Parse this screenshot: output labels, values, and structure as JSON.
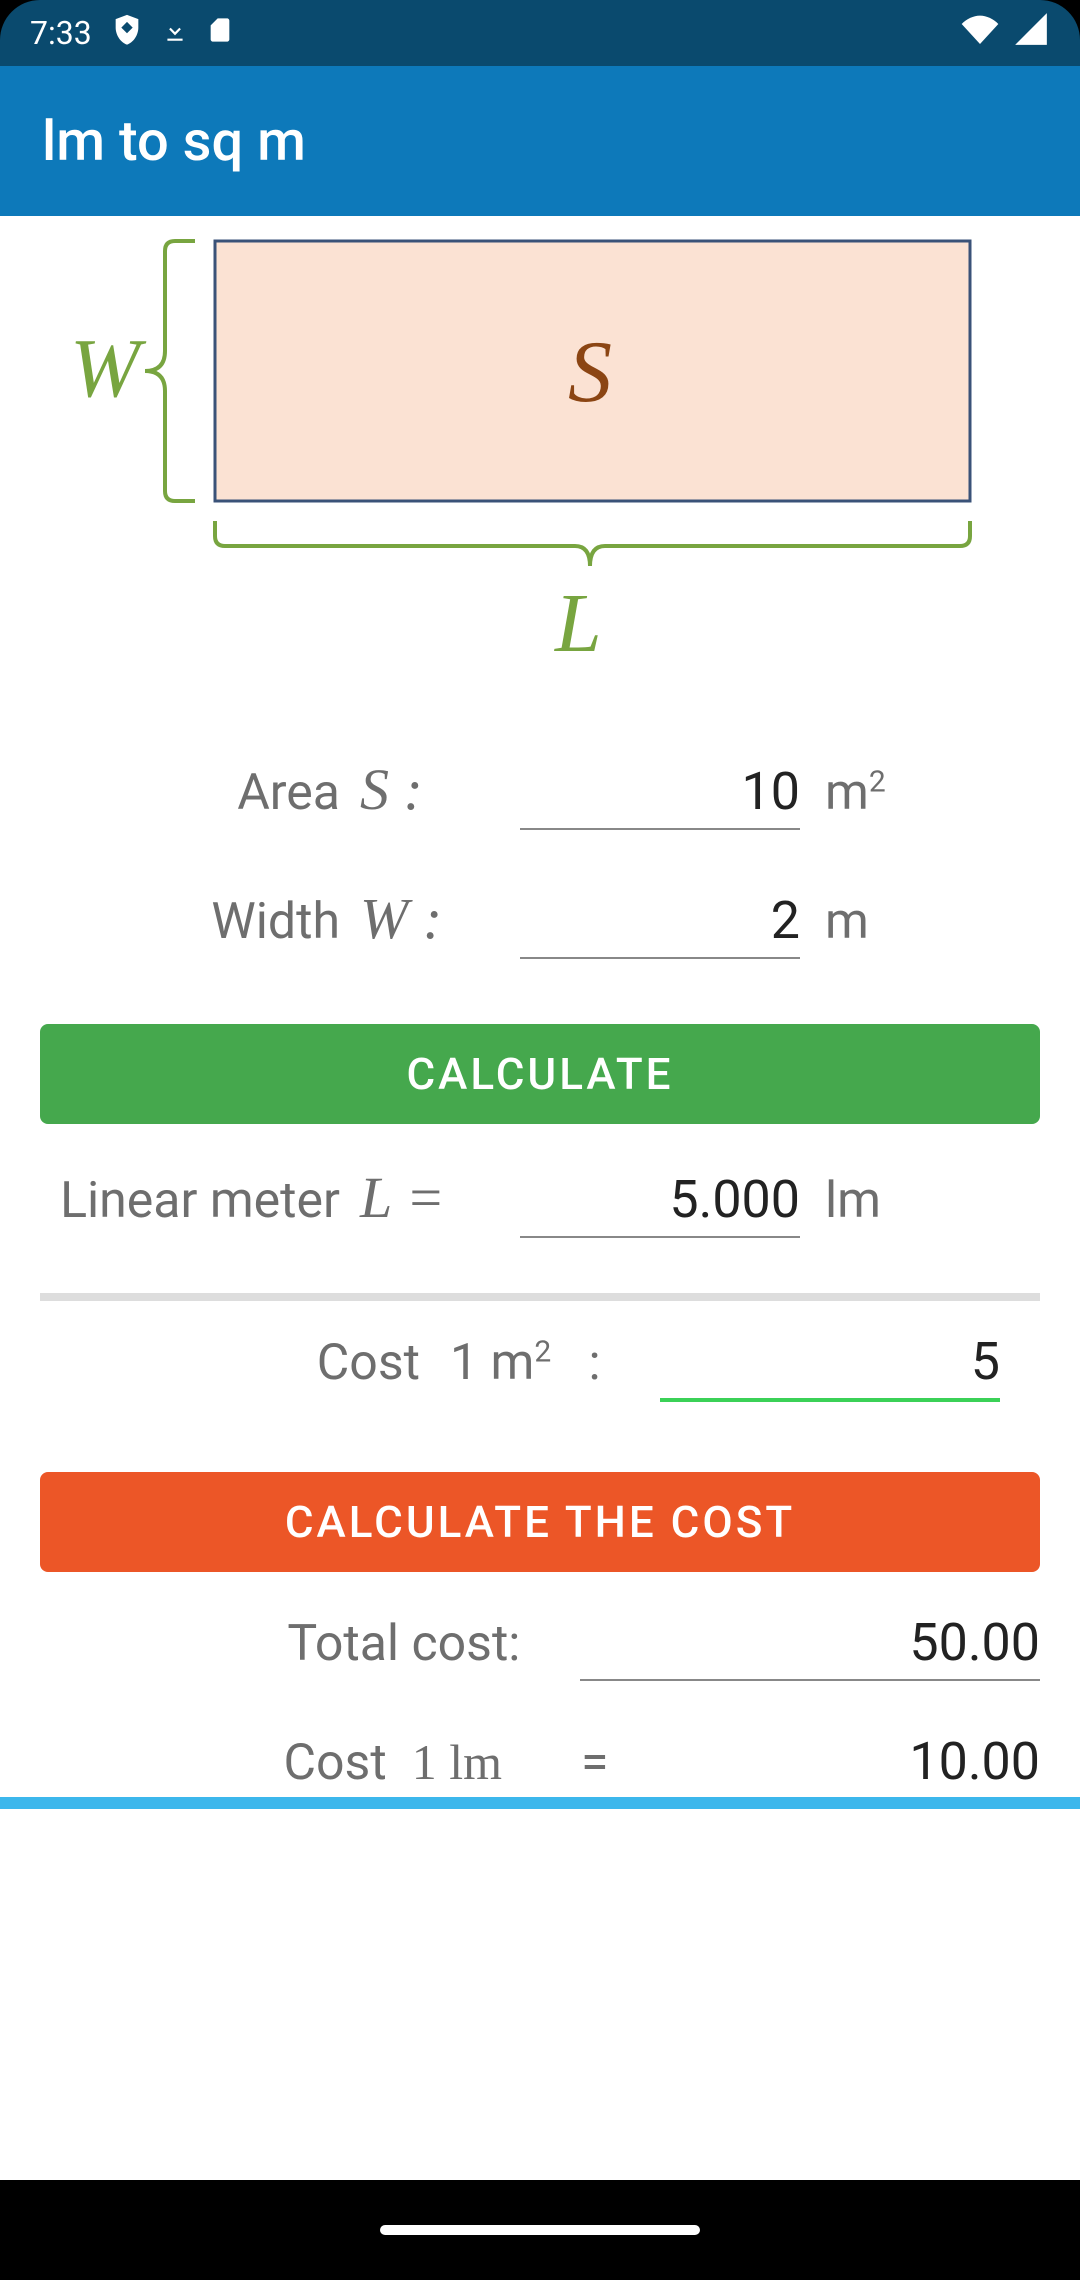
{
  "status": {
    "time": "7:33"
  },
  "appbar": {
    "title": "lm to sq m"
  },
  "diagram": {
    "W": "W",
    "S": "S",
    "L": "L"
  },
  "fields": {
    "area": {
      "label": "Area",
      "symbol": "S :",
      "value": "10",
      "unit_base": "m",
      "unit_sup": "2"
    },
    "width": {
      "label": "Width",
      "symbol": "W :",
      "value": "2",
      "unit": "m"
    },
    "linear": {
      "label": "Linear meter",
      "symbol": "L =",
      "value": "5.000",
      "unit": "lm"
    }
  },
  "buttons": {
    "calculate": "CALCULATE",
    "calculate_cost": "CALCULATE THE COST"
  },
  "cost": {
    "label": "Cost",
    "unit_base": "1 m",
    "unit_sup": "2",
    "colon": ":",
    "value": "5"
  },
  "results": {
    "total_cost_label": "Total cost:",
    "total_cost_value": "50.00",
    "cost_lm_label": "Cost",
    "cost_lm_unit": "1 lm",
    "cost_lm_eq": "=",
    "cost_lm_value": "10.00"
  }
}
